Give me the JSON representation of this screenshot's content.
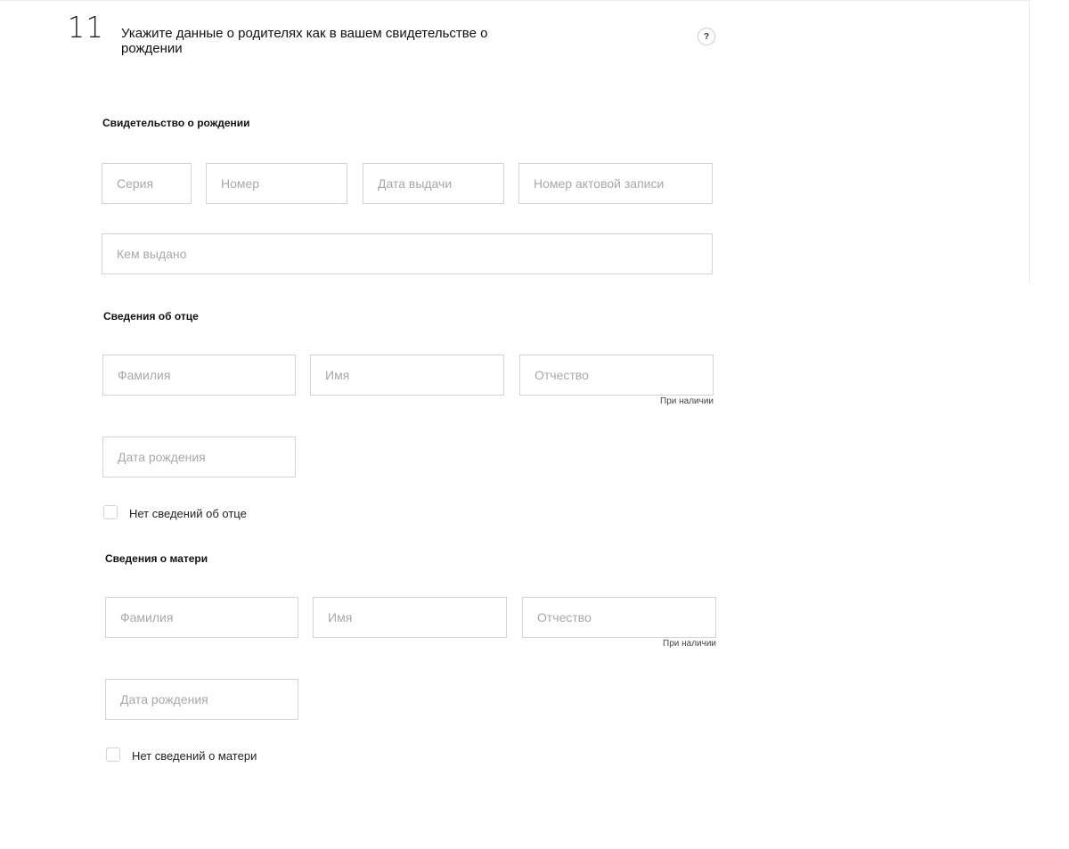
{
  "step": {
    "number": "11",
    "title": "Укажите данные о родителях как в вашем свидетельстве о рождении",
    "help_icon": "question-mark-icon",
    "help_label": "?"
  },
  "certificate": {
    "heading": "Свидетельство о рождении",
    "series_placeholder": "Серия",
    "number_placeholder": "Номер",
    "issue_date_placeholder": "Дата выдачи",
    "record_number_placeholder": "Номер актовой записи",
    "issued_by_placeholder": "Кем выдано"
  },
  "father": {
    "heading": "Сведения об отце",
    "last_name_placeholder": "Фамилия",
    "first_name_placeholder": "Имя",
    "patronymic_placeholder": "Отчество",
    "patronymic_hint": "При наличии",
    "birth_date_placeholder": "Дата рождения",
    "no_info_label": "Нет сведений об отце"
  },
  "mother": {
    "heading": "Сведения о матери",
    "last_name_placeholder": "Фамилия",
    "first_name_placeholder": "Имя",
    "patronymic_placeholder": "Отчество",
    "patronymic_hint": "При наличии",
    "birth_date_placeholder": "Дата рождения",
    "no_info_label": "Нет сведений о матери"
  }
}
